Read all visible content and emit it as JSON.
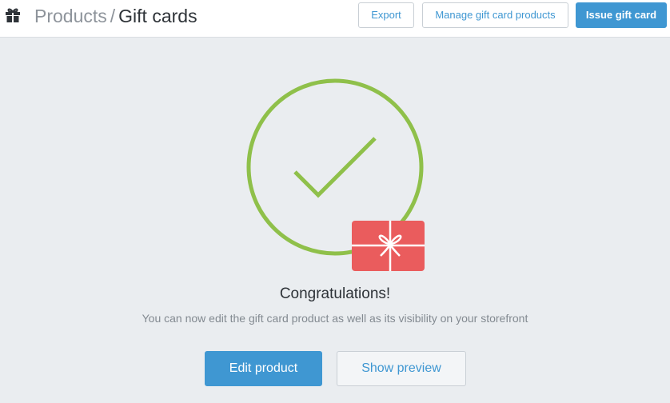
{
  "header": {
    "breadcrumb_parent": "Products",
    "breadcrumb_separator": "/",
    "breadcrumb_current": "Gift cards",
    "page_icon": "gift-icon"
  },
  "toolbar": {
    "export_label": "Export",
    "manage_label": "Manage gift card products",
    "issue_label": "Issue gift card"
  },
  "main": {
    "illustration_icons": [
      "check-circle-icon",
      "gift-card-icon"
    ],
    "title": "Congratulations!",
    "subtitle": "You can now edit the gift card product as well as its visibility on your storefront",
    "edit_label": "Edit product",
    "preview_label": "Show preview"
  },
  "colors": {
    "accent": "#3f97d2",
    "success_green": "#8fc04a",
    "gift_card_red": "#ea5c5d",
    "background": "#eaedf0"
  }
}
